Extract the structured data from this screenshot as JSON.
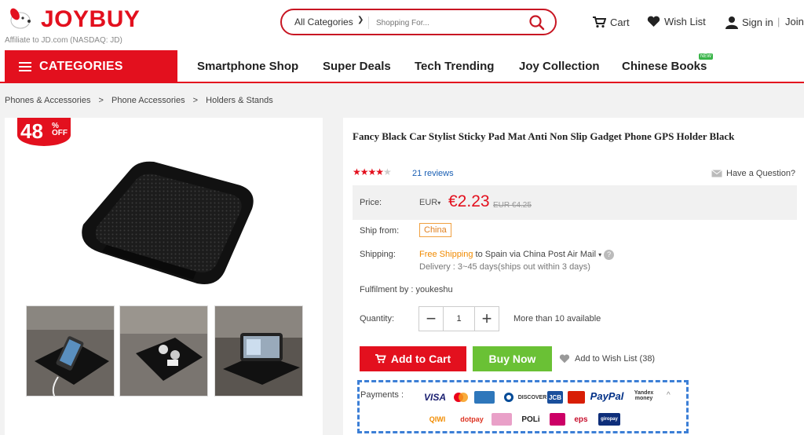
{
  "header": {
    "logo_text": "JOYBUY",
    "affiliate": "Affiliate to JD.com (NASDAQ: JD)",
    "search_category": "All Categories",
    "search_placeholder": "Shopping For...",
    "cart_label": "Cart",
    "wishlist_label": "Wish List",
    "signin_label": "Sign in",
    "separator": "|",
    "join_label": "Join"
  },
  "nav": {
    "categories_label": "CATEGORIES",
    "items": [
      "Smartphone Shop",
      "Super Deals",
      "Tech Trending",
      "Joy Collection",
      "Chinese Books"
    ],
    "new_badge": "NEW"
  },
  "breadcrumb": [
    "Phones & Accessories",
    "Phone Accessories",
    "Holders & Stands"
  ],
  "breadcrumb_sep": ">",
  "gallery": {
    "discount_value": "48",
    "discount_pct": "%",
    "discount_off": "OFF",
    "thumbnail_count": 3
  },
  "product": {
    "title": "Fancy Black Car Stylist Sticky Pad Mat Anti Non Slip Gadget Phone GPS Holder Black",
    "rating": 4,
    "rating_max": 5,
    "stars_on": "★★★★",
    "stars_off": "★",
    "reviews": "21 reviews",
    "question": "Have a Question?",
    "price_label": "Price:",
    "currency": "EUR",
    "currency_caret": "▾",
    "price": "€2.23",
    "old_price": "EUR €4.25",
    "ship_from_label": "Ship from:",
    "ship_from": "China",
    "shipping_label": "Shipping:",
    "shipping_free": "Free Shipping",
    "shipping_rest": " to Spain via China Post Air Mail",
    "shipping_caret": "▾",
    "help_mark": "?",
    "delivery": "Delivery : 3~45 days(ships out within 3 days)",
    "fulfilment": "Fulfilment by : youkeshu",
    "quantity_label": "Quantity:",
    "minus": "−",
    "plus": "+",
    "quantity": "1",
    "availability": "More than 10 available",
    "add_to_cart": "Add to Cart",
    "buy_now": "Buy Now",
    "wishlist": "Add to Wish List (38)",
    "payments_label": "Payments :",
    "collapse_mark": "^"
  },
  "payments": {
    "row1": [
      "VISA",
      "",
      "",
      "",
      "DISCOVER",
      "JCB",
      "",
      "PayPal",
      "Yandex money"
    ],
    "row2": [
      "QIWI",
      "dotpay",
      "",
      "POLi",
      "",
      "eps",
      "giropay"
    ]
  },
  "colors": {
    "brand_red": "#e3101e",
    "buy_green": "#6ac135",
    "link_blue": "#1a5fb4",
    "highlight_blue": "#3c7fd6"
  }
}
